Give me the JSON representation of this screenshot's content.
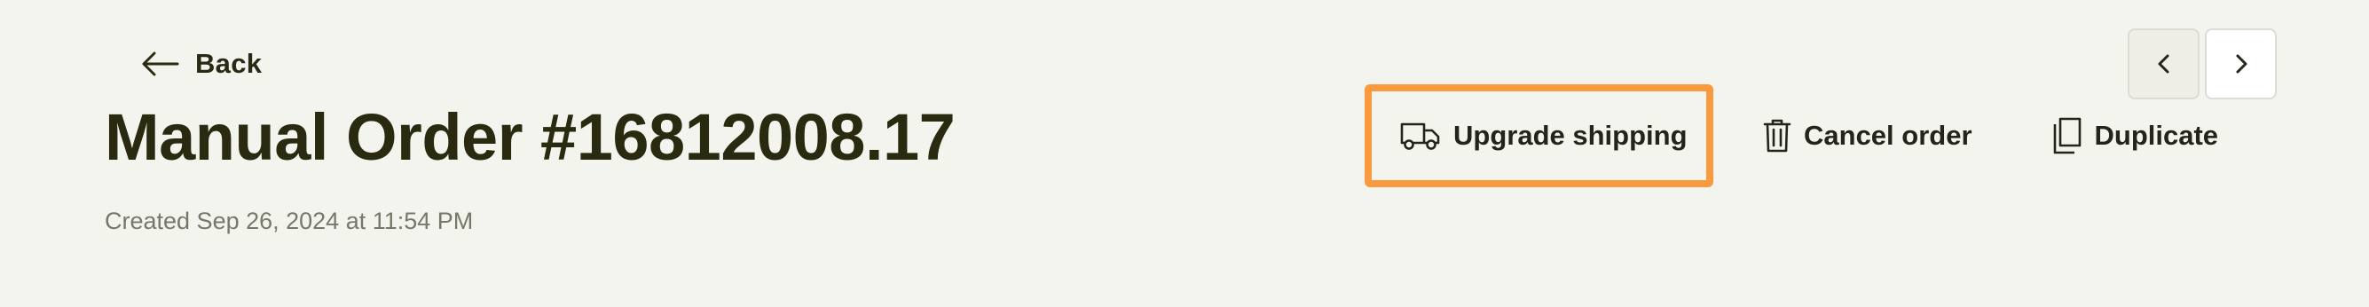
{
  "header": {
    "back_label": "Back",
    "title": "Manual Order #16812008.17",
    "created": "Created Sep 26, 2024 at 11:54 PM"
  },
  "actions": {
    "upgrade_shipping": "Upgrade shipping",
    "cancel_order": "Cancel order",
    "duplicate": "Duplicate"
  },
  "pager": {
    "prev_icon": "chevron-left-icon",
    "next_icon": "chevron-right-icon"
  },
  "colors": {
    "background": "#f4f4ee",
    "highlight": "#f99a3e",
    "text": "#2a2a14"
  }
}
